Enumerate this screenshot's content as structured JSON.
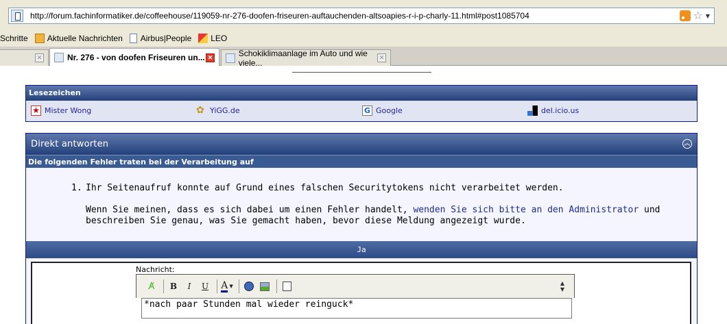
{
  "browser": {
    "url": "http://forum.fachinformatiker.de/coffeehouse/119059-nr-276-doofen-friseuren-auftauchenden-altsoapies-r-i-p-charly-11.html#post1085704",
    "bookmarks": [
      {
        "label": "Schritte"
      },
      {
        "label": "Aktuelle Nachrichten"
      },
      {
        "label": "Airbus|People"
      },
      {
        "label": "LEO"
      }
    ],
    "tabs": [
      {
        "label": ""
      },
      {
        "label": "Nr. 276 - von doofen Friseuren un..."
      },
      {
        "label": "Schokiklimaanlage im Auto und wie viele..."
      }
    ]
  },
  "lesezeichen": {
    "title": "Lesezeichen",
    "items": [
      {
        "label": "Mister Wong",
        "icon": "mister-wong-icon"
      },
      {
        "label": "YiGG.de",
        "icon": "yigg-icon"
      },
      {
        "label": "Google",
        "icon": "google-icon"
      },
      {
        "label": "del.icio.us",
        "icon": "delicious-icon"
      }
    ]
  },
  "reply": {
    "title": "Direkt antworten",
    "error_header": "Die folgenden Fehler traten bei der Verarbeitung auf",
    "error_number": "1.",
    "error_message": "Ihr Seitenaufruf konnte auf Grund eines falschen Securitytokens nicht verarbeitet werden.",
    "detail_before": "Wenn Sie meinen, dass es sich dabei um einen Fehler handelt, ",
    "detail_link": "wenden Sie sich bitte an den Administrator",
    "detail_after": " und beschreiben Sie genau, was Sie gemacht haben, bevor diese Meldung angezeigt wurde.",
    "ja_label": "Ja",
    "nachricht_label": "Nachricht:",
    "textarea_value": "*nach paar Stunden mal wieder reinguck*"
  },
  "colors": {
    "header_dark": "#23407a",
    "header_light": "#5f79ad",
    "link": "#22229c",
    "box_border": "#0b198c"
  }
}
